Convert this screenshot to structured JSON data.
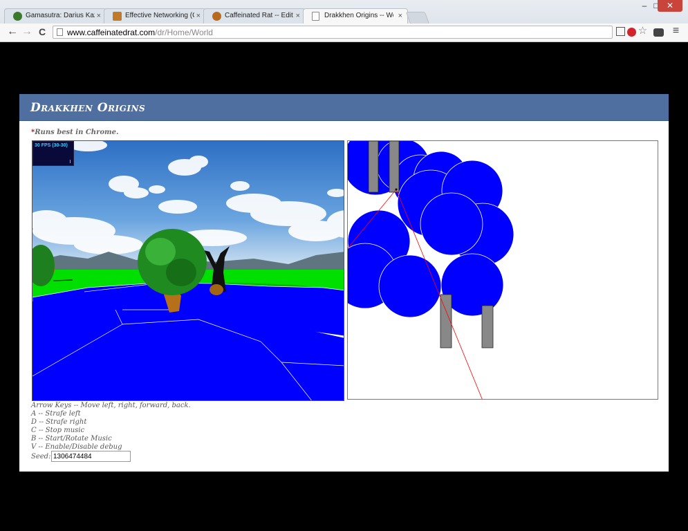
{
  "browser": {
    "tabs": [
      {
        "label": "Gamasutra: Darius Kazemi",
        "active": false,
        "icon": "gamasutra-icon",
        "color": "#3b7a2a"
      },
      {
        "label": "Effective Networking (Get",
        "active": false,
        "icon": "person-icon",
        "color": "#c07a2a"
      },
      {
        "label": "Caffeinated Rat -- Edit Exp",
        "active": false,
        "icon": "rat-icon",
        "color": "#b86a20"
      },
      {
        "label": "Drakkhen Origins -- World",
        "active": true,
        "icon": "page-icon",
        "color": "#888888"
      }
    ],
    "url_domain": "www.caffeinatedrat.com",
    "url_path": "/dr/Home/World",
    "back_glyph": "←",
    "forward_glyph": "→",
    "reload_glyph": "C",
    "menu_glyph": "≡",
    "star_glyph": "☆",
    "minimize_glyph": "–",
    "maximize_glyph": "□",
    "close_glyph": "✕",
    "tab_close_glyph": "×"
  },
  "page": {
    "title": "Drakkhen Origins",
    "note_star": "*",
    "note": "Runs best in Chrome.",
    "fps": "30 FPS (30-30)",
    "help_lines": [
      "Arrow Keys -- Move left, right, forward, back.",
      "A -- Strafe left",
      "D -- Strafe right",
      "C -- Stop music",
      "B -- Start/Rotate Music",
      "V -- Enable/Disable debug"
    ],
    "seed_label": "Seed:",
    "seed_value": "1306474484"
  },
  "colors": {
    "banner": "#4e6f9f",
    "water": "#0000ff",
    "grass": "#00e000",
    "sky": "#4a8fd8",
    "trunk": "#888888",
    "sightline": "#ff0000"
  }
}
